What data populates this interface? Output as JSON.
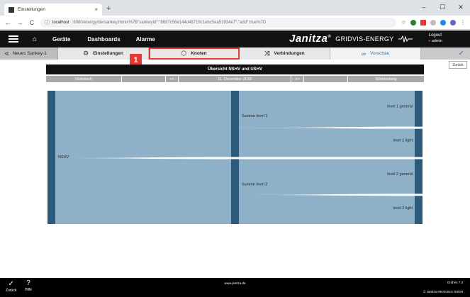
{
  "browser": {
    "tab_title": "Einstellungen",
    "tab_close": "×",
    "new_tab": "+",
    "win_minimize": "–",
    "win_maximize": "☐",
    "win_close": "✕",
    "back": "←",
    "forward": "→",
    "reload": "C",
    "url_host": "localhost",
    "url_path": ":8080/energy/de/sankey.html#%7B\"sankeyId\":\"8697c56e144d48719c1ebc5ea51934e7\",\"add\":true%7D"
  },
  "header": {
    "nav": [
      "Geräte",
      "Dashboards",
      "Alarme"
    ],
    "brand": "Janitza",
    "brand_reg": "®",
    "product": "GRIDVIS-ENERGY",
    "logout": "Logout",
    "user": "admin"
  },
  "toolbar": {
    "back_label": "Neues Sankey-1",
    "items": [
      "Einstellungen",
      "Knoten",
      "Verbindungen",
      "Vorschau"
    ],
    "badge": "1",
    "tooltip": "Zurück"
  },
  "chart": {
    "title": "Übersicht NSHV und USHV",
    "mode_left": "Historisch",
    "prev": "<<",
    "date": "11. Dezember 2018",
    "next": ">>",
    "mode_right": "Wirkleistung"
  },
  "chart_data": {
    "type": "sankey",
    "nodes": [
      {
        "id": "NSHV",
        "label": "NSHV",
        "column": 0,
        "value": 100
      },
      {
        "id": "S1",
        "label": "Summe level 1",
        "column": 1,
        "value": 50
      },
      {
        "id": "S2",
        "label": "Summe level 2",
        "column": 1,
        "value": 50
      },
      {
        "id": "L1G",
        "label": "level 1 general",
        "column": 2,
        "value": 28
      },
      {
        "id": "L1L",
        "label": "level 1 light",
        "column": 2,
        "value": 22
      },
      {
        "id": "L2G",
        "label": "level 2 general",
        "column": 2,
        "value": 27
      },
      {
        "id": "L2L",
        "label": "level 2 light",
        "column": 2,
        "value": 23
      }
    ],
    "links": [
      {
        "source": "NSHV",
        "target": "S1",
        "value": 50
      },
      {
        "source": "NSHV",
        "target": "S2",
        "value": 50
      },
      {
        "source": "S1",
        "target": "L1G",
        "value": 28
      },
      {
        "source": "S1",
        "target": "L1L",
        "value": 22
      },
      {
        "source": "S2",
        "target": "L2G",
        "value": 27
      },
      {
        "source": "S2",
        "target": "L2L",
        "value": 23
      }
    ],
    "colors": {
      "node": "#2b5a7c",
      "link": "#8fb1c8"
    }
  },
  "footer": {
    "back": "Zurück",
    "help": "Hilfe",
    "site": "www.janitza.de",
    "version": "GridVis 7.3",
    "copyright": "© Janitza electronics GmbH"
  }
}
